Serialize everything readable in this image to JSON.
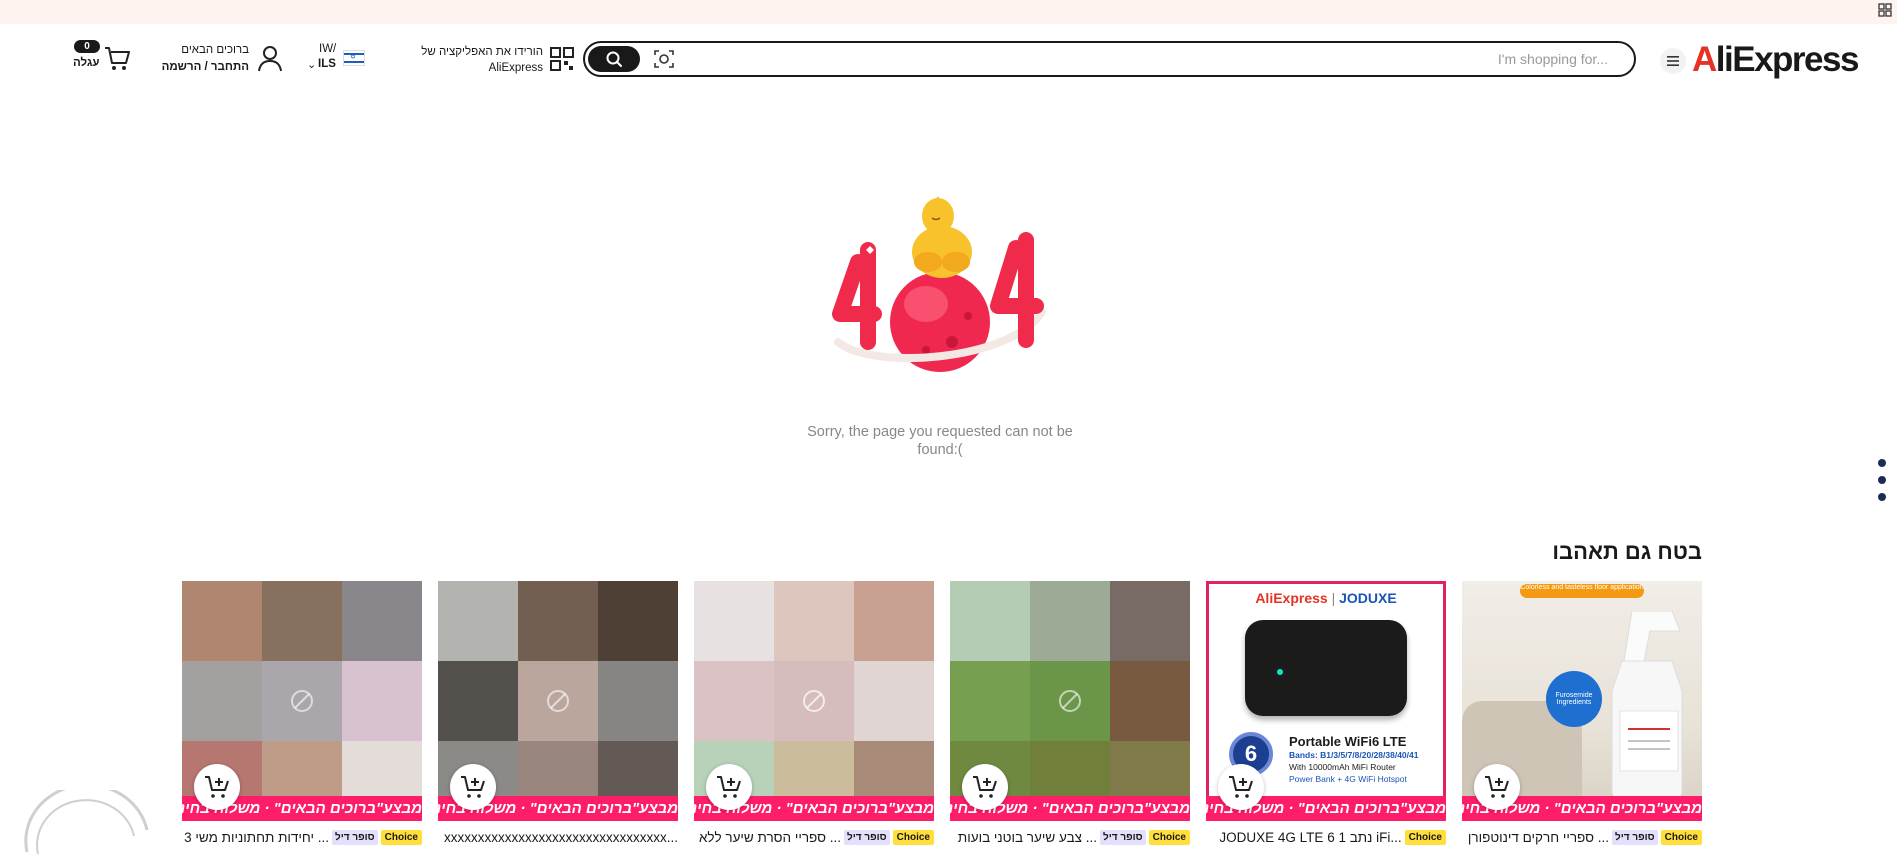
{
  "header": {
    "logo_a": "A",
    "logo_rest": "liExpress",
    "search": {
      "placeholder": "I'm shopping for..."
    },
    "app": {
      "line1": "הורידו את האפליקציה של",
      "line2": "AliExpress"
    },
    "lang": {
      "top": "IW/",
      "currency": "ILS"
    },
    "account": {
      "line1": "ברוכים הבאים",
      "line2": "התחבר / הרשמה"
    },
    "cart": {
      "count": "0",
      "label": "עגלה"
    }
  },
  "notfound": {
    "line1": "Sorry, the page you requested can not be",
    "line2": "found:("
  },
  "recommend": {
    "title": "בטח גם תאהבו",
    "promo": "מבצע\"ברוכים הבאים\" · משלוח בחינם",
    "choice": "Choice",
    "super": "סופר דיל",
    "cards": [
      {
        "text": "ספריי חרקים דינוטפורן ..."
      },
      {
        "text": "JODUXE 4G LTE נתב 1 6 iFi..."
      },
      {
        "text": "צבע שיער בוטני בועות ..."
      },
      {
        "text": "ספריי הסרת שיער ללא ..."
      },
      {
        "text": "xxxxxxxxxxxxxxxxxxxxxxxxxxxxxxxxx..."
      },
      {
        "text": "3 יחידות תחתוניות משי ..."
      }
    ],
    "router": {
      "brand_left": "AliExpress",
      "brand_right": "JODUXE",
      "title": "Portable WiFi6 LTE",
      "bands": "Bands: B1/3/5/7/8/20/28/38/40/41",
      "line3": "With 10000mAh MiFi Router",
      "line4": "Power Bank + 4G WiFi Hotspot"
    },
    "spray": {
      "banner": "Colorless and tasteless floor application",
      "badge": "Furosemide Ingredients"
    }
  },
  "colors": {
    "accent": "#e43225",
    "promo": "#fd1d68",
    "choice": "#ffe03a"
  }
}
